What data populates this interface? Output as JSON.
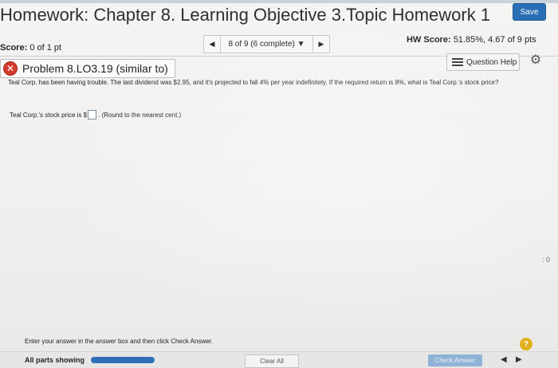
{
  "header": {
    "title": "Homework: Chapter 8. Learning Objective 3.Topic Homework 1",
    "save_label": "Save"
  },
  "score_row": {
    "score_label": "Score:",
    "score_value": "0 of 1 pt",
    "nav_label": "8 of 9 (6 complete)",
    "hw_score_label": "HW Score:",
    "hw_score_value": "51.85%, 4.67 of 9 pts"
  },
  "problem": {
    "title": "Problem 8.LO3.19 (similar to)",
    "question_help_label": "Question Help",
    "question_text": "Teal Corp. has been having trouble. The last dividend was $2.95, and it's projected to fall 4% per year indefinitely. If the required return is 8%, what is Teal Corp.'s stock price?",
    "answer_prefix": "Teal Corp.'s stock price is $",
    "answer_value": "",
    "answer_suffix": ". (Round to the nearest cent.)"
  },
  "side_mark": ": 0",
  "footer": {
    "instructions": "Enter your answer in the answer box and then click Check Answer.",
    "all_parts_label": "All parts showing",
    "progress": 1.0,
    "clear_all_label": "Clear All",
    "check_answer_label": "Check Answer",
    "help_symbol": "?"
  },
  "colors": {
    "accent": "#2a6fb6",
    "error": "#d23b2e",
    "help": "#e0b01d"
  }
}
